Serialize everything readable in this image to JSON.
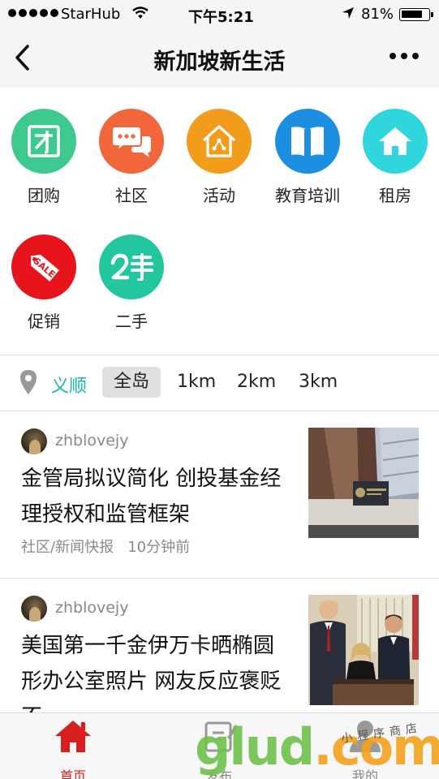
{
  "status_bar": {
    "carrier": "StarHub",
    "time": "下午5:21",
    "battery": "81%",
    "battery_level": 0.81
  },
  "nav": {
    "title": "新加坡新生活"
  },
  "categories": [
    {
      "label": "团购",
      "icon": "group-buy-icon",
      "color": "#3ec98e"
    },
    {
      "label": "社区",
      "icon": "chat-bubbles-icon",
      "color": "#f2663b"
    },
    {
      "label": "活动",
      "icon": "activity-house-icon",
      "color": "#f19c1b"
    },
    {
      "label": "教育培训",
      "icon": "book-icon",
      "color": "#1d8fe1"
    },
    {
      "label": "租房",
      "icon": "home-icon",
      "color": "#2fd6dc"
    },
    {
      "label": "促销",
      "icon": "sale-tag-icon",
      "color": "#e8141c"
    },
    {
      "label": "二手",
      "icon": "second-hand-icon",
      "color": "#22c7a0"
    }
  ],
  "filter": {
    "location": "义顺",
    "options": [
      "全岛",
      "1km",
      "2km",
      "3km"
    ],
    "selected": "全岛",
    "accent": "#1db6a8"
  },
  "posts": [
    {
      "author": "zhblovejy",
      "headline": "金管局拟议简化 创投基金经理授权和监管框架",
      "meta": "社区/新闻快报   10分钟前"
    },
    {
      "author": "zhblovejy",
      "headline": "美国第一千金伊万卡晒椭圆形办公室照片 网友反应褒贬不一"
    }
  ],
  "tabs": [
    {
      "label": "首页",
      "icon": "home-icon",
      "active": true
    },
    {
      "label": "发布",
      "icon": "publish-icon",
      "active": false
    },
    {
      "label": "我的",
      "icon": "profile-icon",
      "active": false
    }
  ],
  "watermark": {
    "brand": "glud.com",
    "handwriting": "小程序商店"
  }
}
